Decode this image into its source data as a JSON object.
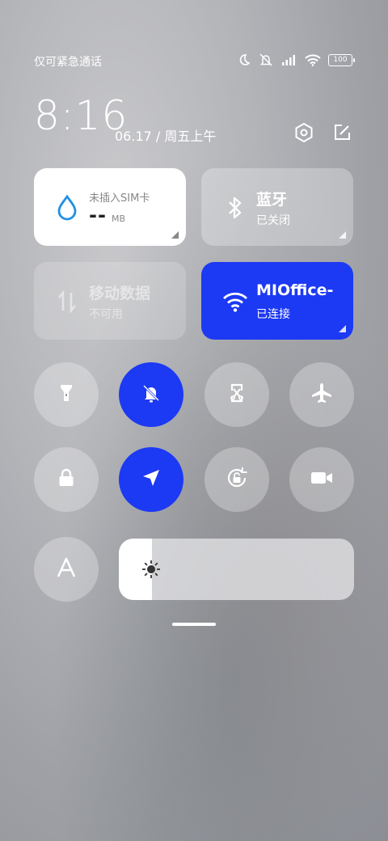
{
  "status_bar": {
    "carrier_text": "仅可紧急通话",
    "icons": [
      "moon-icon",
      "mute-vibrate-icon",
      "signal-icon",
      "wifi-icon",
      "battery-icon"
    ],
    "battery_level": "100"
  },
  "header": {
    "time": "8:16",
    "date": "06.17 / 周五上午",
    "icons": [
      "settings-icon",
      "edit-icon"
    ]
  },
  "tiles": {
    "data": {
      "label": "未插入SIM卡",
      "value": "--",
      "unit": "MB",
      "icon": "water-drop-icon"
    },
    "bluetooth": {
      "title": "蓝牙",
      "status": "已关闭",
      "icon": "bluetooth-icon"
    },
    "mobile_data": {
      "title": "移动数据",
      "status": "不可用",
      "icon": "mobile-data-icon"
    },
    "wifi": {
      "title": "MIOffice-",
      "status": "已连接",
      "icon": "wifi-icon"
    }
  },
  "toggles": [
    {
      "name": "flashlight",
      "icon": "flashlight-icon",
      "active": false
    },
    {
      "name": "mute",
      "icon": "bell-off-icon",
      "active": true
    },
    {
      "name": "screenshot",
      "icon": "screenshot-scissors-icon",
      "active": false
    },
    {
      "name": "airplane-mode",
      "icon": "airplane-icon",
      "active": false
    },
    {
      "name": "lock-screen",
      "icon": "lock-icon",
      "active": false
    },
    {
      "name": "location",
      "icon": "location-arrow-icon",
      "active": true
    },
    {
      "name": "rotation-lock",
      "icon": "rotation-lock-icon",
      "active": false
    },
    {
      "name": "screen-recorder",
      "icon": "video-camera-icon",
      "active": false
    },
    {
      "name": "auto-brightness",
      "icon": "font-a-icon",
      "active": false
    }
  ],
  "brightness": {
    "level": 0.14,
    "icon": "sun-icon"
  },
  "colors": {
    "accent": "#1c39f3",
    "tile_white": "#ffffff",
    "data_icon": "#1e90e6"
  }
}
